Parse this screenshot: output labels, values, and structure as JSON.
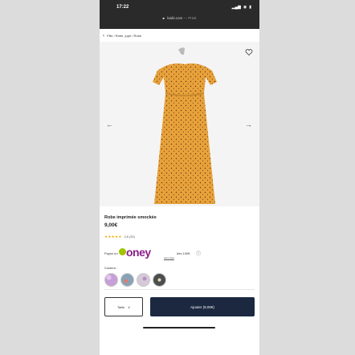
{
  "status": {
    "time": "17:22",
    "signal": "▂▄▆",
    "wifi": "◉",
    "battery": "▮"
  },
  "browser": {
    "url": "kiabi.com",
    "tail": "— Privé",
    "lock": "■"
  },
  "breadcrumb": {
    "back": "‹",
    "path": "Fille / Robe, jupe / Robe"
  },
  "gallery": {
    "prev": "←",
    "next": "→"
  },
  "product": {
    "title": "Robe imprimée smockée",
    "price": "9,00€",
    "stars": "★★★★★",
    "rating": "4,6 (33)"
  },
  "oney": {
    "pre": "Payez en",
    "logo": "oney",
    "sub": "sans frais",
    "tail": "dès 100€",
    "info_icon": "ⓘ"
  },
  "color_label": "Couleur :",
  "swatches": [
    "#c79fd8",
    "#88a2b6",
    "#d6c9d9",
    "#4a4f4d"
  ],
  "actions": {
    "size": "Taille",
    "size_chevron": "∨",
    "add": "Ajouter (9,00€)"
  },
  "colors": {
    "dress": "#e8a13a",
    "button": "#1b2840",
    "oney": "#8b1d8b",
    "stars": "#f0a800"
  }
}
